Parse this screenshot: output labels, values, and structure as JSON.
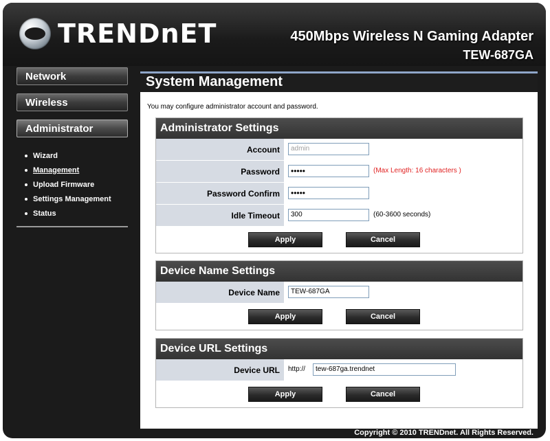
{
  "header": {
    "logo_text": "TRENDnET",
    "product_title": "450Mbps Wireless N Gaming Adapter",
    "product_model": "TEW-687GA"
  },
  "sidebar": {
    "network": "Network",
    "wireless": "Wireless",
    "administrator": "Administrator",
    "items": [
      {
        "label": "Wizard"
      },
      {
        "label": "Management"
      },
      {
        "label": "Upload Firmware"
      },
      {
        "label": "Settings Management"
      },
      {
        "label": "Status"
      }
    ]
  },
  "main": {
    "title": "System Management",
    "intro": "You may configure administrator account and password.",
    "admin": {
      "title": "Administrator Settings",
      "account_label": "Account",
      "account_value": "admin",
      "password_label": "Password",
      "password_value": "•••••",
      "password_hint": "(Max Length: 16 characters )",
      "confirm_label": "Password Confirm",
      "confirm_value": "•••••",
      "idle_label": "Idle Timeout",
      "idle_value": "300",
      "idle_hint": "(60-3600 seconds)",
      "apply": "Apply",
      "cancel": "Cancel"
    },
    "device_name": {
      "title": "Device Name Settings",
      "label": "Device Name",
      "value": "TEW-687GA",
      "apply": "Apply",
      "cancel": "Cancel"
    },
    "device_url": {
      "title": "Device URL Settings",
      "label": "Device URL",
      "prefix": "http://",
      "value": "tew-687ga.trendnet",
      "apply": "Apply",
      "cancel": "Cancel"
    }
  },
  "footer": {
    "copyright": "Copyright © 2010 TRENDnet. All Rights Reserved."
  },
  "colors": {
    "background": "#1b1b1b",
    "accent": "#8fa6c9",
    "label_bg": "#d6dbe3",
    "hint_red": "#e01f1f"
  }
}
